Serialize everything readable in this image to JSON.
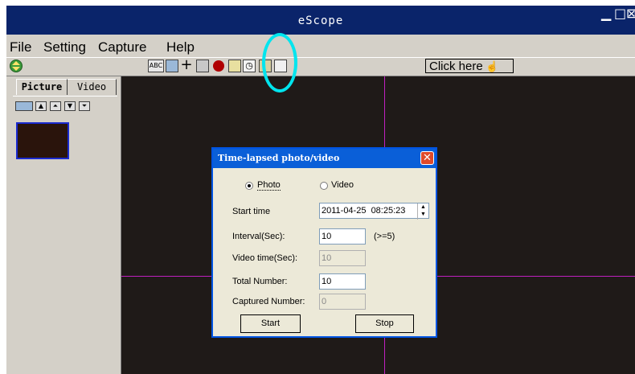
{
  "window": {
    "title": "eScope",
    "controls": [
      "minimize-icon",
      "maximize-icon",
      "close-icon"
    ]
  },
  "menu": {
    "items": [
      "File",
      "Setting",
      "Capture",
      "Help"
    ]
  },
  "toolbar": {
    "buttons": [
      "text-tool-icon",
      "camera-icon",
      "crosshair-icon",
      "snapshot-icon",
      "record-icon",
      "measure-icon",
      "clock-icon",
      "folder-icon",
      "save-icon"
    ],
    "click_here_label": "Click here",
    "highlight_color": "#00e5ee"
  },
  "left_panel": {
    "tabs": [
      "Picture",
      "Video"
    ],
    "active_tab": "Picture",
    "nav_buttons": [
      "film-icon",
      "up-icon",
      "top-icon",
      "down-icon",
      "bottom-icon"
    ]
  },
  "dialog": {
    "title": "Time-lapsed photo/video",
    "mode_options": [
      "Photo",
      "Video"
    ],
    "selected_mode": "Photo",
    "fields": {
      "start_time": {
        "label": "Start time",
        "value": "2011-04-25  08:25:23"
      },
      "interval": {
        "label": "Interval(Sec):",
        "value": "10",
        "hint": "(>=5)"
      },
      "video_time": {
        "label": "Video time(Sec):",
        "value": "10"
      },
      "total_number": {
        "label": "Total Number:",
        "value": "10"
      },
      "captured_number": {
        "label": "Captured Number:",
        "value": "0"
      }
    },
    "start_label": "Start",
    "stop_label": "Stop"
  },
  "colors": {
    "titlebar": "#0a246a",
    "chrome": "#d4d0c8",
    "viewport_bg": "#1f1a18",
    "reticle": "#c020c0",
    "dialog_title": "#0a5fd8"
  }
}
